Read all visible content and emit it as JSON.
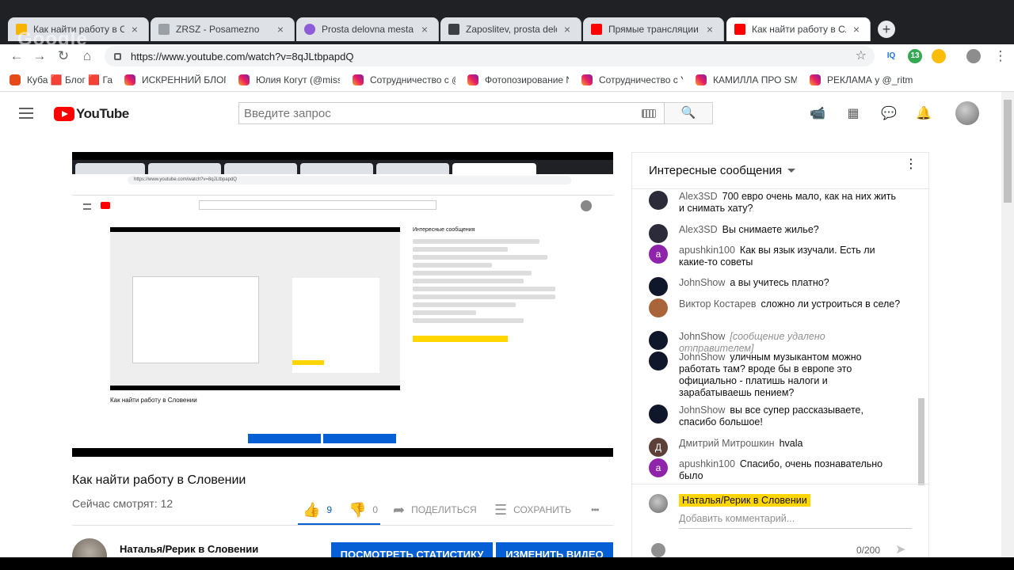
{
  "browser": {
    "tabs": [
      {
        "title": "Как найти работу в Сл...",
        "icon_color": "#f4b400"
      },
      {
        "title": "ZRSZ - Posamezno",
        "icon_color": "#9aa0a6"
      },
      {
        "title": "Prosta delovna mesta: I...",
        "icon_color": "#8e5cd9"
      },
      {
        "title": "Zaposlitev, prosta delov...",
        "icon_color": "#3c4043"
      },
      {
        "title": "Прямые трансляции - ...",
        "icon_color": "#ff0000"
      },
      {
        "title": "Как найти работу в Сл...",
        "icon_color": "#ff0000"
      }
    ],
    "close_glyph": "×",
    "new_tab_glyph": "+",
    "watermark": "Google",
    "url": "https://www.youtube.com/watch?v=8qJLtbpapdQ",
    "nav": {
      "back": "←",
      "forward": "→",
      "reload": "↻",
      "home": "⌂",
      "star": "☆"
    },
    "extensions": [
      "IQ",
      "13"
    ],
    "bookmarks": [
      "Куба 🟥 Блог 🟥 Гаван",
      "ИСКРЕННИЙ БЛОГЕ",
      "Юлия Когут (@missk",
      "Сотрудничество с @",
      "Фотопозирование N",
      "Сотрудничество с Y",
      "КАМИЛЛА ПРО SMI",
      "РЕКЛАМА у @_ritmo"
    ]
  },
  "youtube": {
    "logo_text": "YouTube",
    "search_placeholder": "Введите запрос",
    "icons": {
      "search": "🔍",
      "camera": "📹",
      "apps": "▦",
      "chat": "💬",
      "bell": "🔔"
    },
    "video": {
      "title": "Как найти работу в Словении",
      "viewers": "Сейчас смотрят: 12",
      "likes": "9",
      "dislikes": "0",
      "share": "ПОДЕЛИТЬСЯ",
      "save": "СОХРАНИТЬ",
      "more": "•••",
      "owner": "Наталья/Рерик в Словении",
      "btn_stats": "ПОСМОТРЕТЬ СТАТИСТИКУ",
      "btn_edit": "ИЗМЕНИТЬ ВИДЕО"
    },
    "inner_screenshot": {
      "url": "https://www.youtube.com/watch?v=8qJLtbpapdQ",
      "title": "Как найти работу в Словении",
      "chat_title": "Интересные сообщения"
    },
    "chat": {
      "title": "Интересные сообщения",
      "kebab": "⋮",
      "messages": [
        {
          "author": "Alex3SD",
          "text": "700 евро очень мало, как на них жить и снимать хату?",
          "avatar": "#2b2b3a",
          "initial": ""
        },
        {
          "author": "Alex3SD",
          "text": "Вы снимаете жилье?",
          "avatar": "#2b2b3a",
          "initial": ""
        },
        {
          "author": "apushkin100",
          "text": "Как вы язык изучали. Есть ли какие-то советы",
          "avatar": "#8e24aa",
          "initial": "a"
        },
        {
          "author": "JohnShow",
          "text": "а вы учитесь платно?",
          "avatar": "#11172a",
          "initial": ""
        },
        {
          "author": "Виктор Костарев",
          "text": "сложно ли устроиться в селе?",
          "avatar": "#a9643a",
          "initial": ""
        },
        {
          "author": "JohnShow",
          "text": "[сообщение удалено отправителем]",
          "avatar": "#11172a",
          "initial": "",
          "deleted": true
        },
        {
          "author": "JohnShow",
          "text": "уличным музыкантом можно работать там? вроде бы в европе это официально - платишь налоги и зарабатываешь пением?",
          "avatar": "#11172a",
          "initial": ""
        },
        {
          "author": "JohnShow",
          "text": "вы все супер рассказываете, спасибо большое!",
          "avatar": "#11172a",
          "initial": ""
        },
        {
          "author": "Дмитрий Митрошкин",
          "text": "hvala",
          "avatar": "#5d4037",
          "initial": "Д"
        },
        {
          "author": "apushkin100",
          "text": "Спасибо, очень познавательно было",
          "avatar": "#8e24aa",
          "initial": "a"
        }
      ],
      "composer_name": "Наталья/Рерик в Словении",
      "composer_placeholder": "Добавить комментарий...",
      "char_count": "0/200"
    }
  }
}
